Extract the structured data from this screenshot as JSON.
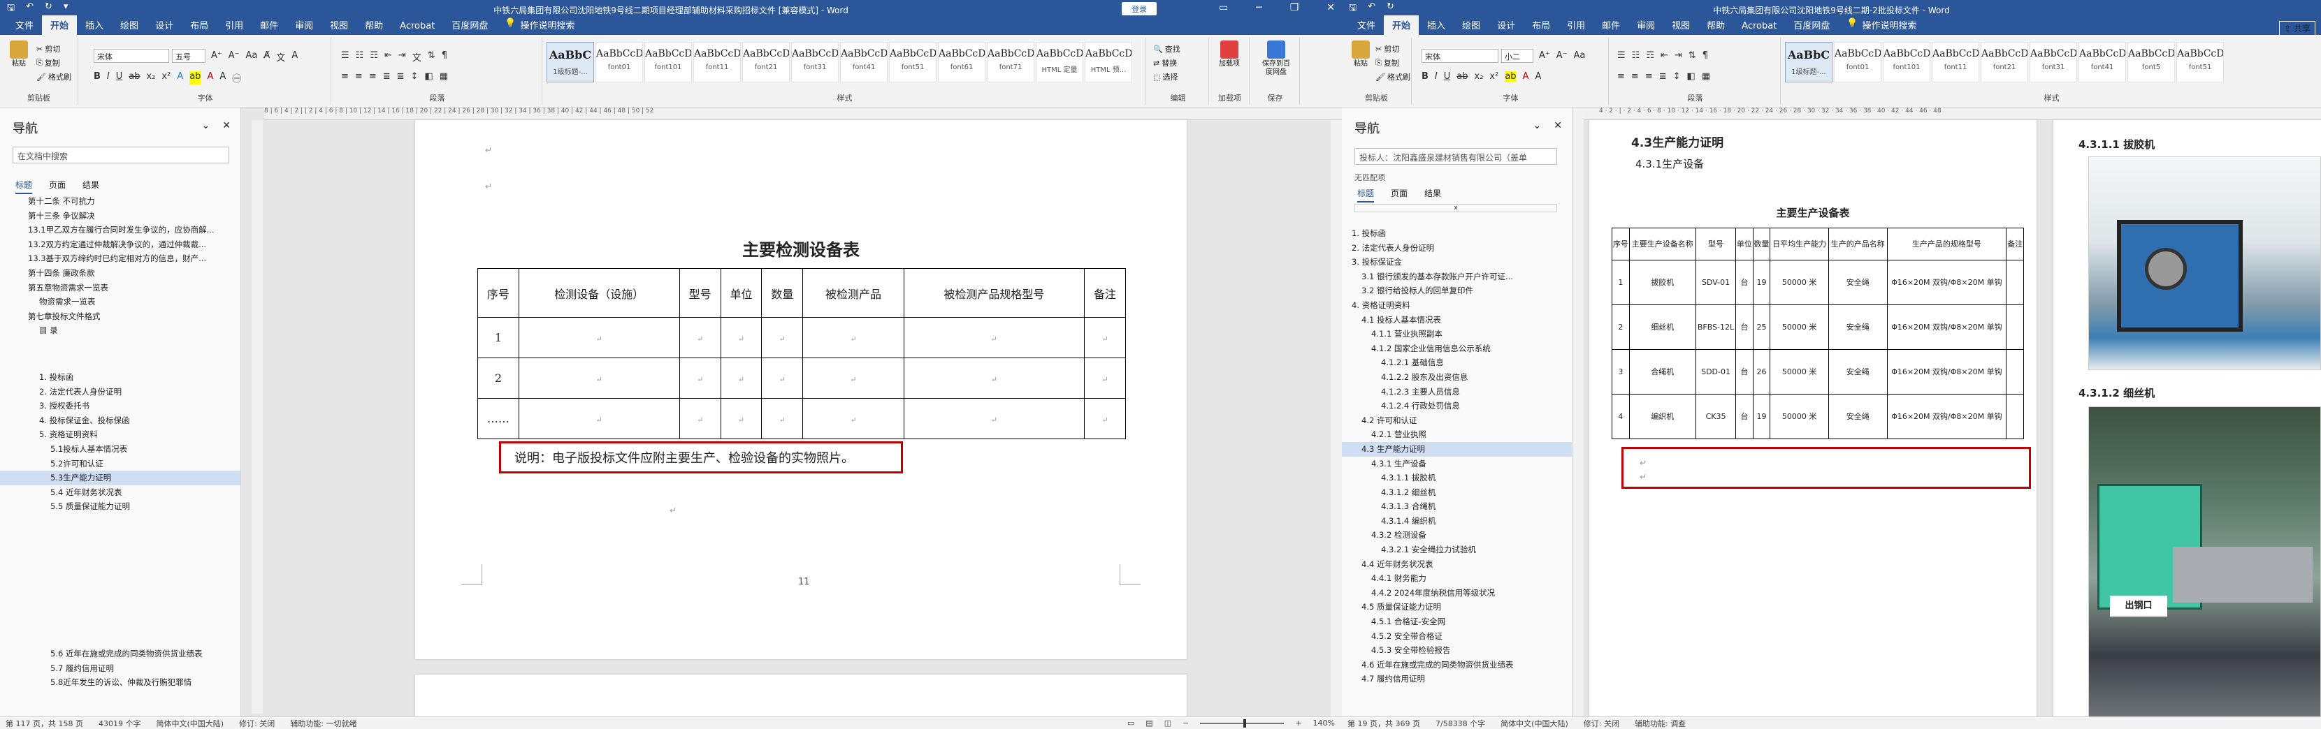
{
  "left_window": {
    "title": "中铁六局集团有限公司沈阳地铁9号线二期项目经理部辅助材料采购招标文件 [兼容模式] - Word",
    "login_label": "登录",
    "tabs": [
      "文件",
      "开始",
      "插入",
      "绘图",
      "设计",
      "布局",
      "引用",
      "邮件",
      "审阅",
      "视图",
      "帮助",
      "Acrobat",
      "百度网盘"
    ],
    "tell_me": "操作说明搜索",
    "ribbon": {
      "clipboard": {
        "paste": "粘贴",
        "cut": "剪切",
        "copy": "复制",
        "format_painter": "格式刷",
        "label": "剪贴板"
      },
      "font": {
        "name": "宋体",
        "size": "五号",
        "label": "字体"
      },
      "paragraph_label": "段落",
      "styles": [
        {
          "preview": "AaBbC",
          "name": "1级标题-..."
        },
        {
          "preview": "AaBbCcDd",
          "name": "font01"
        },
        {
          "preview": "AaBbCcDd",
          "name": "font101"
        },
        {
          "preview": "AaBbCcDd",
          "name": "font11"
        },
        {
          "preview": "AaBbCcDd",
          "name": "font21"
        },
        {
          "preview": "AaBbCcDd",
          "name": "font31"
        },
        {
          "preview": "AaBbCcDd",
          "name": "font41"
        },
        {
          "preview": "AaBbCcDc",
          "name": "font51"
        },
        {
          "preview": "AaBbCcDc",
          "name": "font61"
        },
        {
          "preview": "AaBbCcDd",
          "name": "font71"
        },
        {
          "preview": "AaBbCcD",
          "name": "HTML 定量"
        },
        {
          "preview": "AaBbCcDc",
          "name": "HTML 预..."
        }
      ],
      "styles_label": "样式",
      "editing": {
        "find": "查找",
        "replace": "替换",
        "select": "选择",
        "label": "编辑"
      },
      "addin": {
        "button": "加载项",
        "label": "加载项"
      },
      "baidu": {
        "button": "保存到百度网盘",
        "label": "保存"
      }
    },
    "ruler_text": "8 | 6 | 4 | 2 | | 2 | 4 | 6 | 8 | 10 | 12 | 14 | 16 | 18 | 20 | 22 | 24 | 26 | 28 | 30 | 32 | 34 | 36 | 38 | 40 | 42 | 44 | 46 | 48 | 50 | 52",
    "nav": {
      "title": "导航",
      "search_placeholder": "在文档中搜索",
      "tabs": [
        "标题",
        "页面",
        "结果"
      ],
      "items_top": [
        "第十二条 不可抗力",
        "第十三条  争议解决",
        "13.1甲乙双方在履行合同时发生争议的，应协商解...",
        "13.2双方约定通过仲裁解决争议的，通过仲裁裁...",
        "13.3基于双方缔约时已约定相对方的信息，财产...",
        "第十四条 廉政条款",
        "第五章物资需求一览表",
        "物资需求一览表",
        "第七章投标文件格式",
        "目 录"
      ],
      "items_mid": [
        "1. 投标函",
        "2. 法定代表人身份证明",
        "3. 授权委托书",
        "4. 投标保证金、投标保函",
        "5. 资格证明资料",
        "5.1投标人基本情况表",
        "5.2许可和认证",
        "5.3生产能力证明",
        "5.4 近年财务状况表",
        "5.5 质量保证能力证明"
      ],
      "items_bottom": [
        "5.6 近年在施或完成的同类物资供货业绩表",
        "5.7 履约信用证明",
        "5.8近年发生的诉讼、仲裁及行贿犯罪情"
      ]
    },
    "document": {
      "table_title": "主要检测设备表",
      "columns": [
        "序号",
        "检测设备（设施）",
        "型号",
        "单位",
        "数量",
        "被检测产品",
        "被检测产品规格型号",
        "备注"
      ],
      "rows": [
        "1",
        "2",
        "……"
      ],
      "note": "说明：电子版投标文件应附主要生产、检验设备的实物照片。",
      "page_number": "11"
    },
    "status": {
      "page": "第 117 页，共 158 页",
      "words": "43019 个字",
      "lang": "简体中文(中国大陆)",
      "revise": "修订: 关闭",
      "accessibility": "辅助功能: 一切就绪",
      "zoom": "140%"
    }
  },
  "right_window": {
    "title": "中铁六局集团有限公司沈阳地铁9号线二期-2批投标文件 - Word",
    "share_label": "共享",
    "tabs": [
      "文件",
      "开始",
      "插入",
      "绘图",
      "设计",
      "布局",
      "引用",
      "邮件",
      "审阅",
      "视图",
      "帮助",
      "Acrobat",
      "百度网盘"
    ],
    "tell_me": "操作说明搜索",
    "ribbon": {
      "clipboard": {
        "paste": "粘贴",
        "cut": "剪切",
        "copy": "复制",
        "format_painter": "格式刷",
        "label": "剪贴板"
      },
      "font": {
        "name": "宋体",
        "size": "小二",
        "label": "字体"
      },
      "paragraph_label": "段落",
      "styles": [
        {
          "preview": "AaBbC",
          "name": "1级标题-..."
        },
        {
          "preview": "AaBbCcDd",
          "name": "font01"
        },
        {
          "preview": "AaBbCcDd",
          "name": "font101"
        },
        {
          "preview": "AaBbCcDd",
          "name": "font11"
        },
        {
          "preview": "AaBbCcDd",
          "name": "font21"
        },
        {
          "preview": "AaBbCcDd",
          "name": "font31"
        },
        {
          "preview": "AaBbCcDd",
          "name": "font41"
        },
        {
          "preview": "AaBbCcDc",
          "name": "font5"
        },
        {
          "preview": "AaBbCcDc",
          "name": "font51"
        }
      ],
      "styles_label": "样式"
    },
    "nav": {
      "title": "导航",
      "search_value": "投标人：沈阳鑫盛泉建材销售有限公司（盖单",
      "no_match": "无匹配项",
      "tabs": [
        "标题",
        "页面",
        "结果"
      ],
      "items": [
        "1. 投标函",
        "2. 法定代表人身份证明",
        "3. 投标保证金",
        "3.1 银行颁发的基本存款账户开户许可证...",
        "3.2 银行给投标人的回单复印件",
        "4. 资格证明资料",
        "4.1 投标人基本情况表",
        "4.1.1 营业执照副本",
        "4.1.2 国家企业信用信息公示系统",
        "4.1.2.1 基础信息",
        "4.1.2.2 股东及出资信息",
        "4.1.2.3 主要人员信息",
        "4.1.2.4 行政处罚信息",
        "4.2 许可和认证",
        "4.2.1 营业执照",
        "4.3 生产能力证明",
        "4.3.1 生产设备",
        "4.3.1.1 拔胶机",
        "4.3.1.2 细丝机",
        "4.3.1.3 合绳机",
        "4.3.1.4 编织机",
        "4.3.2 检测设备",
        "4.3.2.1 安全绳拉力试验机",
        "4.4 近年财务状况表",
        "4.4.1 财务能力",
        "4.4.2 2024年度纳税信用等级状况",
        "4.5 质量保证能力证明",
        "4.5.1 合格证-安全网",
        "4.5.2 安全带合格证",
        "4.5.3 安全带检验报告",
        "4.6 近年在施或完成的同类物资供货业绩表",
        "4.7 履约信用证明"
      ]
    },
    "document": {
      "heading1": "4.3生产能力证明",
      "heading2": "4.3.1生产设备",
      "table_title": "主要生产设备表",
      "columns": [
        "序号",
        "主要生产设备名称",
        "型号",
        "单位",
        "数量",
        "日平均生产能力",
        "生产的产品名称",
        "生产产品的规格型号",
        "备注"
      ],
      "rows": [
        [
          "1",
          "拔胶机",
          "SDV-01",
          "台",
          "19",
          "50000 米",
          "安全绳",
          "Φ16×20M 双钩/Φ8×20M 单钩"
        ],
        [
          "2",
          "细丝机",
          "BFBS-12L",
          "台",
          "25",
          "50000 米",
          "安全绳",
          "Φ16×20M 双钩/Φ8×20M 单钩"
        ],
        [
          "3",
          "合绳机",
          "SDD-01",
          "台",
          "26",
          "50000 米",
          "安全绳",
          "Φ16×20M 双钩/Φ8×20M 单钩"
        ],
        [
          "4",
          "编织机",
          "CK35",
          "台",
          "19",
          "50000 米",
          "安全绳",
          "Φ16×20M 双钩/Φ8×20M 单钩"
        ]
      ],
      "side_heading1": "4.3.1.1  拔胶机",
      "side_heading2": "4.3.1.2  细丝机",
      "photo_text": "出钢口"
    },
    "status": {
      "page": "第 19 页，共 369 页",
      "words": "7/58338 个字",
      "lang": "简体中文(中国大陆)",
      "revise": "修订: 关闭",
      "accessibility": "辅助功能: 调查"
    }
  }
}
